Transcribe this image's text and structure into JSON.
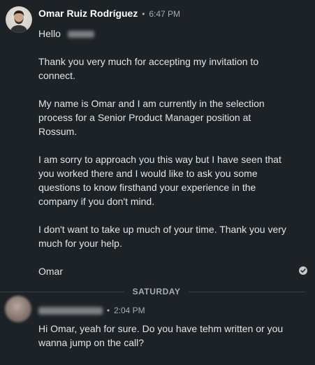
{
  "message_1": {
    "sender": "Omar Ruiz Rodríguez",
    "time": "6:47 PM",
    "greeting": "Hello",
    "paragraphs": [
      "Thank you very much for accepting my invitation to connect.",
      "My name is Omar and I am currently in the selection process for a Senior Product Manager position at Rossum.",
      "I am sorry to approach you this way but I have seen that you worked there and I would like to ask you some questions to know firsthand your experience in the company if you don't mind.",
      "I don't want to take up much of your time. Thank you very much for your help.",
      "Omar"
    ],
    "status_icon": "read-check-icon"
  },
  "divider": {
    "label": "SATURDAY"
  },
  "message_2": {
    "time": "2:04 PM",
    "text": "Hi Omar, yeah for sure. Do you have tehm written or you wanna jump on the call?"
  },
  "colors": {
    "background": "#1d2226",
    "text": "#e3e4e5",
    "muted": "#a9acaf",
    "name": "#ffffff"
  }
}
